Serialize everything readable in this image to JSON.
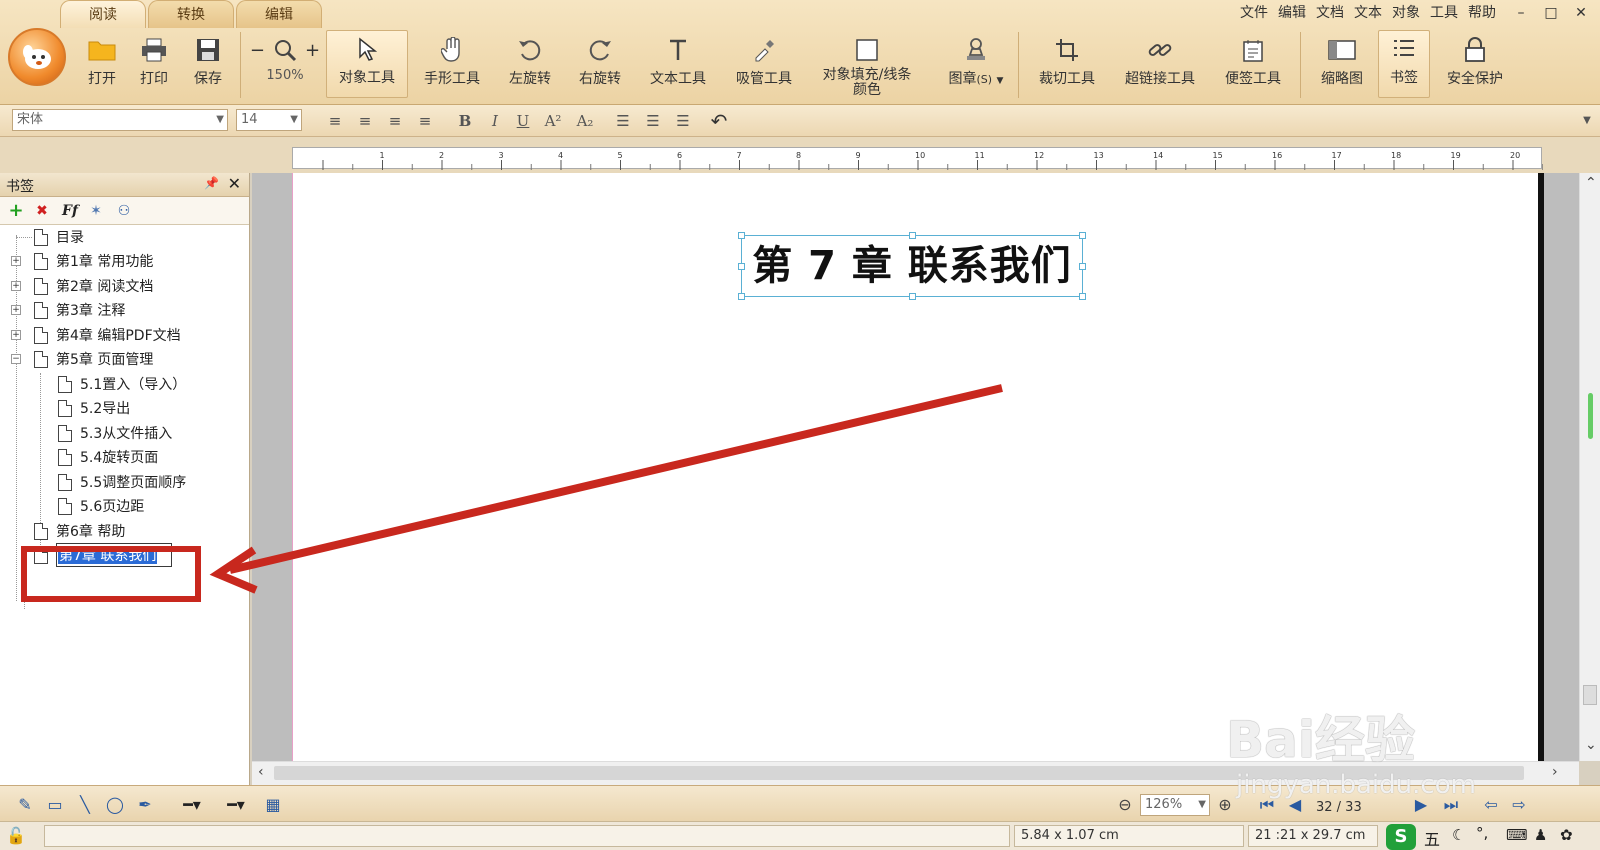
{
  "tabs": [
    {
      "label": "阅读",
      "active": true
    },
    {
      "label": "转换",
      "active": false
    },
    {
      "label": "编辑",
      "active": false
    }
  ],
  "menu": [
    "文件",
    "编辑",
    "文档",
    "文本",
    "对象",
    "工具",
    "帮助"
  ],
  "window_controls": {
    "minimize": "–",
    "maximize": "□",
    "close": "✕"
  },
  "toolbar": {
    "open": "打开",
    "print": "打印",
    "save": "保存",
    "zoom_value": "150%",
    "object_tool": "对象工具",
    "hand_tool": "手形工具",
    "rotate_left": "左旋转",
    "rotate_right": "右旋转",
    "text_tool": "文本工具",
    "dropper_tool": "吸管工具",
    "fill_color_line1": "对象填充/线条",
    "fill_color_line2": "颜色",
    "stamp": "图章",
    "stamp_suffix": "(S)",
    "crop_tool": "裁切工具",
    "hyperlink_tool": "超链接工具",
    "note_tool": "便签工具",
    "thumbnail": "缩略图",
    "bookmark": "书签",
    "security": "安全保护"
  },
  "format_bar": {
    "font": "宋体",
    "size": "14"
  },
  "bookmark_panel": {
    "title": "书签",
    "pin": "ᚹ",
    "close": "✕",
    "items": [
      {
        "label": "目录",
        "level": 0,
        "expander": ""
      },
      {
        "label": "第1章 常用功能",
        "level": 0,
        "expander": "+"
      },
      {
        "label": "第2章 阅读文档",
        "level": 0,
        "expander": "+"
      },
      {
        "label": "第3章 注释",
        "level": 0,
        "expander": "+"
      },
      {
        "label": "第4章 编辑PDF文档",
        "level": 0,
        "expander": "+"
      },
      {
        "label": "第5章 页面管理",
        "level": 0,
        "expander": "−"
      },
      {
        "label": "5.1置入（导入）",
        "level": 1,
        "expander": ""
      },
      {
        "label": "5.2导出",
        "level": 1,
        "expander": ""
      },
      {
        "label": "5.3从文件插入",
        "level": 1,
        "expander": ""
      },
      {
        "label": "5.4旋转页面",
        "level": 1,
        "expander": ""
      },
      {
        "label": "5.5调整页面顺序",
        "level": 1,
        "expander": ""
      },
      {
        "label": "5.6页边距",
        "level": 1,
        "expander": ""
      },
      {
        "label": "第6章 帮助",
        "level": 0,
        "expander": ""
      },
      {
        "label": "第7章 联系我们",
        "level": 0,
        "expander": "",
        "editing": true
      }
    ]
  },
  "document": {
    "heading": "第 7 章  联系我们"
  },
  "bottom": {
    "zoom": "126%",
    "page": "32 / 33",
    "selection_size": "5.84 x 1.07 cm",
    "page_size": "21 :21 x 29.7 cm",
    "ime": "五"
  },
  "watermark": {
    "brand": "Bai经验",
    "url": "jingyan.baidu.com"
  },
  "colors": {
    "annotation_red": "#c8281e",
    "selection_blue": "#5ab0d4",
    "ribbon_tan": "#ecd3a4"
  }
}
